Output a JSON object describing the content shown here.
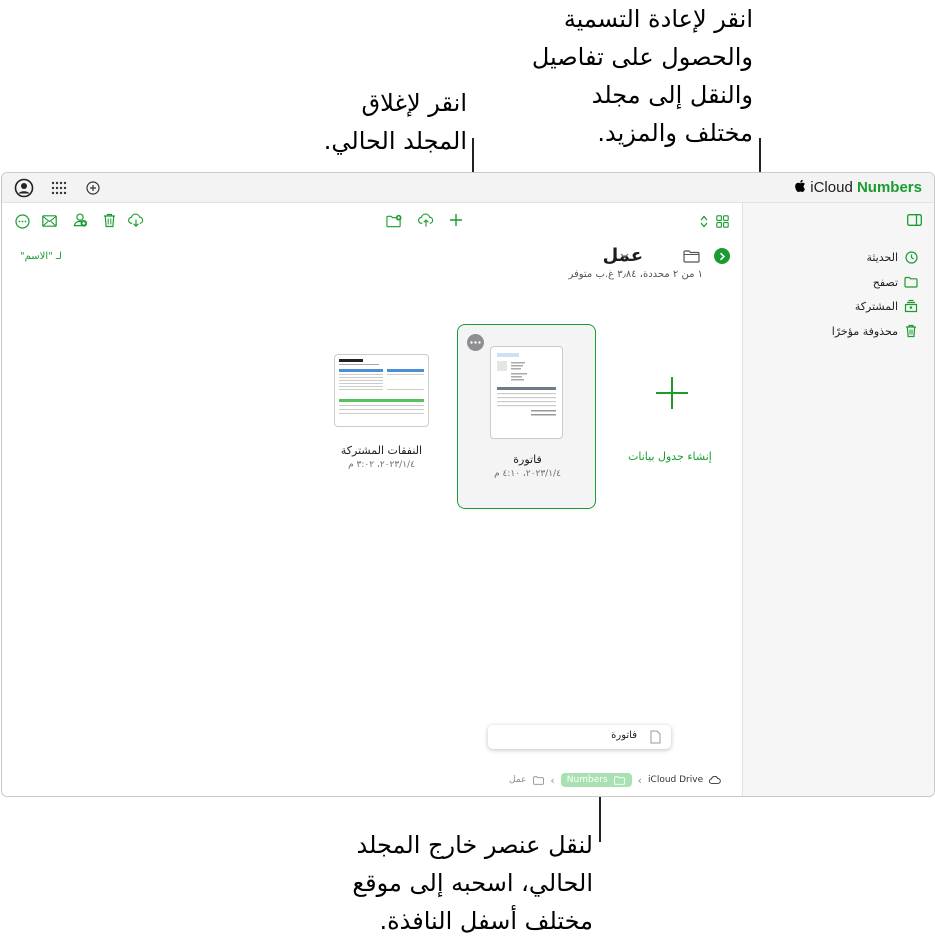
{
  "callouts": {
    "rename": [
      "انقر لإعادة التسمية",
      "والحصول على تفاصيل",
      "والنقل إلى مجلد",
      "مختلف والمزيد."
    ],
    "close_folder": [
      "انقر لإغلاق",
      "المجلد الحالي."
    ],
    "move_item": [
      "لنقل عنصر خارج المجلد",
      "الحالي، اسحبه إلى موقع",
      "مختلف أسفل النافذة."
    ]
  },
  "topbar": {
    "brand_apple": "",
    "brand_icloud": "iCloud",
    "brand_app": "Numbers",
    "icons": [
      "account-icon",
      "apps-grid-icon",
      "add-circle-icon"
    ]
  },
  "sidebar": {
    "items": [
      {
        "label": "الحديثة",
        "icon": "clock-icon"
      },
      {
        "label": "تصفح",
        "icon": "folder-icon"
      },
      {
        "label": "المشتركة",
        "icon": "shared-folder-icon"
      },
      {
        "label": "محذوفة مؤخرًا",
        "icon": "trash-icon"
      }
    ]
  },
  "toolbar": {
    "left_icons": [
      "more-icon",
      "mail-icon",
      "collaborate-icon",
      "trash-icon",
      "download-icon"
    ],
    "middle_icons": [
      "new-folder-icon",
      "upload-icon",
      "plus-icon"
    ],
    "right_icons": [
      "sort-toggle-icon",
      "grid-view-icon"
    ]
  },
  "folder": {
    "title": "عمل",
    "subtitle": "١ من ٢ محددة، ٣٫٨٤ غ.ب متوفر",
    "sort_label": "لـ \"الاسم\""
  },
  "documents": [
    {
      "name": "النفقات المشتركة",
      "date": "٢٠٢٣/١/٤، ٣:٠٢ م",
      "selected": false
    },
    {
      "name": "فاتورة",
      "date": "٢٠٢٣/١/٤، ٤:١٠ م",
      "selected": true
    }
  ],
  "create": {
    "label": "إنشاء جدول بيانات"
  },
  "drag": {
    "label": "فاتورة"
  },
  "breadcrumbs": {
    "items": [
      "iCloud Drive",
      "Numbers",
      "عمل"
    ]
  },
  "colors": {
    "accent": "#1a9c30",
    "accent_light": "#a8e2b3"
  }
}
